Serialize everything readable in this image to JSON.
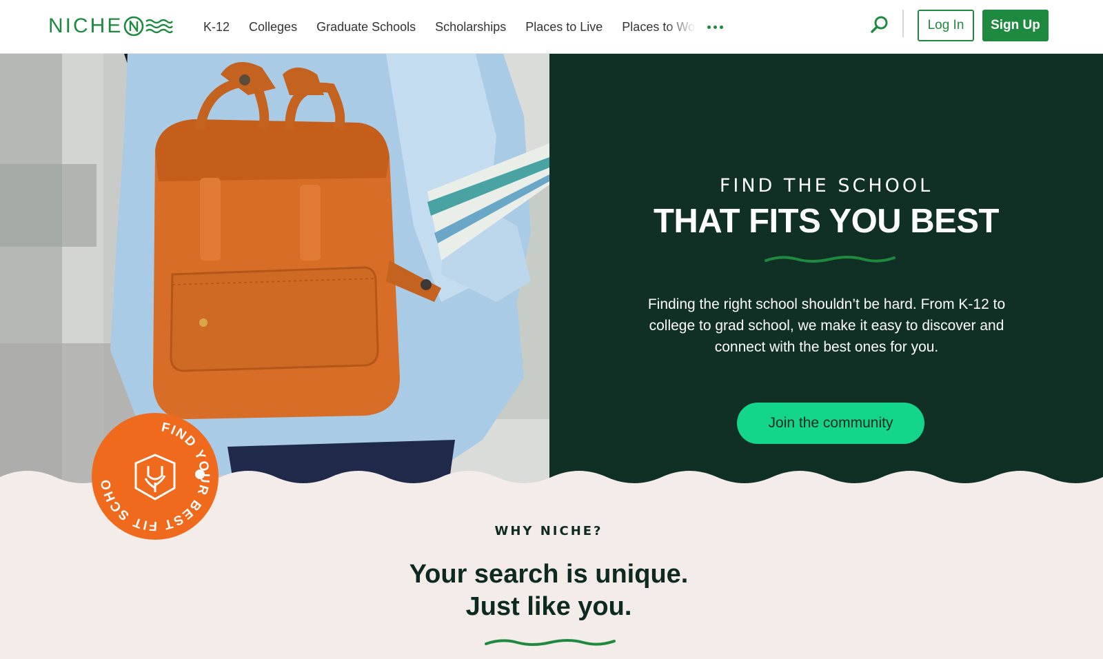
{
  "brand": {
    "logo_text": "NICHE",
    "primary_color": "#1d8a3f",
    "dark_panel_color": "#102f25",
    "cta_color": "#14d68a",
    "cream_color": "#f4ece8",
    "badge_color": "#f06a1d"
  },
  "header": {
    "nav": [
      {
        "label": "K-12"
      },
      {
        "label": "Colleges"
      },
      {
        "label": "Graduate Schools"
      },
      {
        "label": "Scholarships"
      },
      {
        "label": "Places to Live"
      },
      {
        "label": "Places to Work"
      }
    ],
    "more_icon": "ellipsis-icon",
    "search_icon": "search-icon",
    "login_label": "Log In",
    "signup_label": "Sign Up"
  },
  "hero": {
    "kicker": "FIND THE SCHOOL",
    "title": "THAT FITS YOU BEST",
    "description": "Finding the right school shouldn’t be hard. From K-12 to college to grad school, we make it easy to discover and connect with the best ones for you.",
    "cta_label": "Join the community",
    "badge_text": "FIND YOUR BEST FIT SCHOOL"
  },
  "why": {
    "kicker": "WHY NICHE?",
    "title_line1": "Your search is unique.",
    "title_line2": "Just like you."
  }
}
